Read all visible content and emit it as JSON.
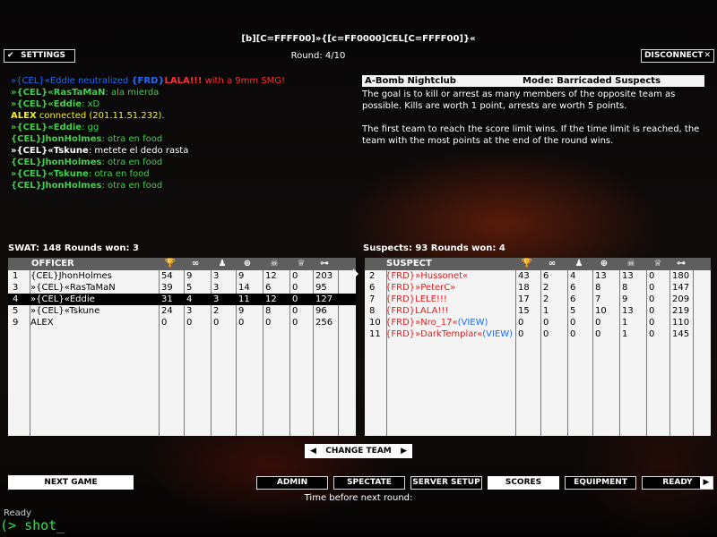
{
  "title": "[b][C=FFFF00]»{[c=FF0000]CEL[C=FFFF00]}«",
  "round": "Round: 4/10",
  "settings_label": "SETTINGS",
  "disconnect_label": "DISCONNECT",
  "chat": [
    {
      "parts": [
        {
          "t": "»{CEL}«Eddie",
          "c": "c-blue"
        },
        {
          "t": " neutralized ",
          "c": "c-blue"
        },
        {
          "t": "{FRD}",
          "c": "c-blue b"
        },
        {
          "t": "LALA!!!",
          "c": "c-red b"
        },
        {
          "t": " with a 9mm SMG!",
          "c": "c-red"
        }
      ]
    },
    {
      "parts": [
        {
          "t": "»{CEL}«RasTaMaN",
          "c": "c-green b"
        },
        {
          "t": ": ala mierda",
          "c": "c-green"
        }
      ]
    },
    {
      "parts": [
        {
          "t": "»{CEL}«Eddie",
          "c": "c-green b"
        },
        {
          "t": ": xD",
          "c": "c-green"
        }
      ]
    },
    {
      "parts": [
        {
          "t": "ALEX",
          "c": "c-yellow b"
        },
        {
          "t": " connected (201.11.51.232).",
          "c": "c-yellow"
        }
      ]
    },
    {
      "parts": [
        {
          "t": "»{CEL}«Eddie",
          "c": "c-green b"
        },
        {
          "t": ": gg",
          "c": "c-green"
        }
      ]
    },
    {
      "parts": [
        {
          "t": "{CEL}JhonHolmes",
          "c": "c-green b"
        },
        {
          "t": ": otra en food",
          "c": "c-green"
        }
      ]
    },
    {
      "parts": [
        {
          "t": "»{CEL}«Tskune",
          "c": "c-white b"
        },
        {
          "t": ": metete el dedo rasta",
          "c": "c-white"
        }
      ]
    },
    {
      "parts": [
        {
          "t": "{CEL}JhonHolmes",
          "c": "c-green b"
        },
        {
          "t": ": otra en food",
          "c": "c-green"
        }
      ]
    },
    {
      "parts": [
        {
          "t": "»{CEL}«Tskune",
          "c": "c-green b"
        },
        {
          "t": ": otra en food",
          "c": "c-green"
        }
      ]
    },
    {
      "parts": [
        {
          "t": "{CEL}JhonHolmes",
          "c": "c-green b"
        },
        {
          "t": ": otra en food",
          "c": "c-green"
        }
      ]
    }
  ],
  "info": {
    "map": "A-Bomb Nightclub",
    "mode": "Mode: Barricaded Suspects",
    "para1": "The goal is to kill or arrest as many members of the opposite team as possible.  Kills are worth 1 point, arrests are worth 5 points.",
    "para2": "The first team to reach the score limit wins.  If the time limit is reached, the team with the most points at the end of the round wins."
  },
  "swat": {
    "header": "SWAT: 148   Rounds won: 3",
    "col_title": "OFFICER",
    "rows": [
      {
        "id": "1",
        "name": "{CEL}JhonHolmes",
        "v": [
          "54",
          "9",
          "3",
          "9",
          "12",
          "0",
          "203"
        ],
        "sel": false
      },
      {
        "id": "3",
        "name": "»{CEL}«RasTaMaN",
        "v": [
          "39",
          "5",
          "3",
          "14",
          "6",
          "0",
          "95"
        ],
        "sel": false
      },
      {
        "id": "4",
        "name": "»{CEL}«Eddie",
        "v": [
          "31",
          "4",
          "3",
          "11",
          "12",
          "0",
          "127"
        ],
        "sel": true
      },
      {
        "id": "5",
        "name": "»{CEL}«Tskune",
        "v": [
          "24",
          "3",
          "2",
          "9",
          "8",
          "0",
          "96"
        ],
        "sel": false
      },
      {
        "id": "9",
        "name": "ALEX",
        "v": [
          "0",
          "0",
          "0",
          "0",
          "0",
          "0",
          "256"
        ],
        "sel": false
      }
    ]
  },
  "suspects": {
    "header": "Suspects: 93   Rounds won: 4",
    "col_title": "SUSPECT",
    "rows": [
      {
        "id": "2",
        "name": "{FRD}»Hussonet«",
        "v": [
          "43",
          "6",
          "4",
          "13",
          "13",
          "0",
          "180"
        ]
      },
      {
        "id": "6",
        "name": "{FRD}»PeterC»",
        "v": [
          "18",
          "2",
          "6",
          "8",
          "8",
          "0",
          "147"
        ]
      },
      {
        "id": "7",
        "name": "{FRD}LELE!!!",
        "v": [
          "17",
          "2",
          "6",
          "7",
          "9",
          "0",
          "209"
        ]
      },
      {
        "id": "8",
        "name": "{FRD}LALA!!!",
        "v": [
          "15",
          "1",
          "5",
          "10",
          "13",
          "0",
          "219"
        ]
      },
      {
        "id": "10",
        "name": "{FRD}»Nro_17«",
        "extra": "(VIEW)",
        "v": [
          "0",
          "0",
          "0",
          "0",
          "1",
          "0",
          "110"
        ]
      },
      {
        "id": "11",
        "name": "{FRD}»DarkTemplar«",
        "extra": "(VIEW)",
        "v": [
          "0",
          "0",
          "0",
          "0",
          "1",
          "0",
          "145"
        ]
      }
    ]
  },
  "change_team": "CHANGE TEAM",
  "buttons": {
    "next_game": "NEXT GAME",
    "admin": "ADMIN",
    "spectate": "SPECTATE",
    "server_setup": "SERVER SETUP",
    "scores": "SCORES",
    "equipment": "EQUIPMENT",
    "ready": "READY"
  },
  "time_label": "Time before next round:",
  "console": {
    "status": "Ready",
    "prompt": "(> shot_"
  },
  "icons": [
    "trophy-icon",
    "handcuffs-icon",
    "arrest-icon",
    "crosshair-icon",
    "skull-icon",
    "medal-icon",
    "ping-icon"
  ]
}
